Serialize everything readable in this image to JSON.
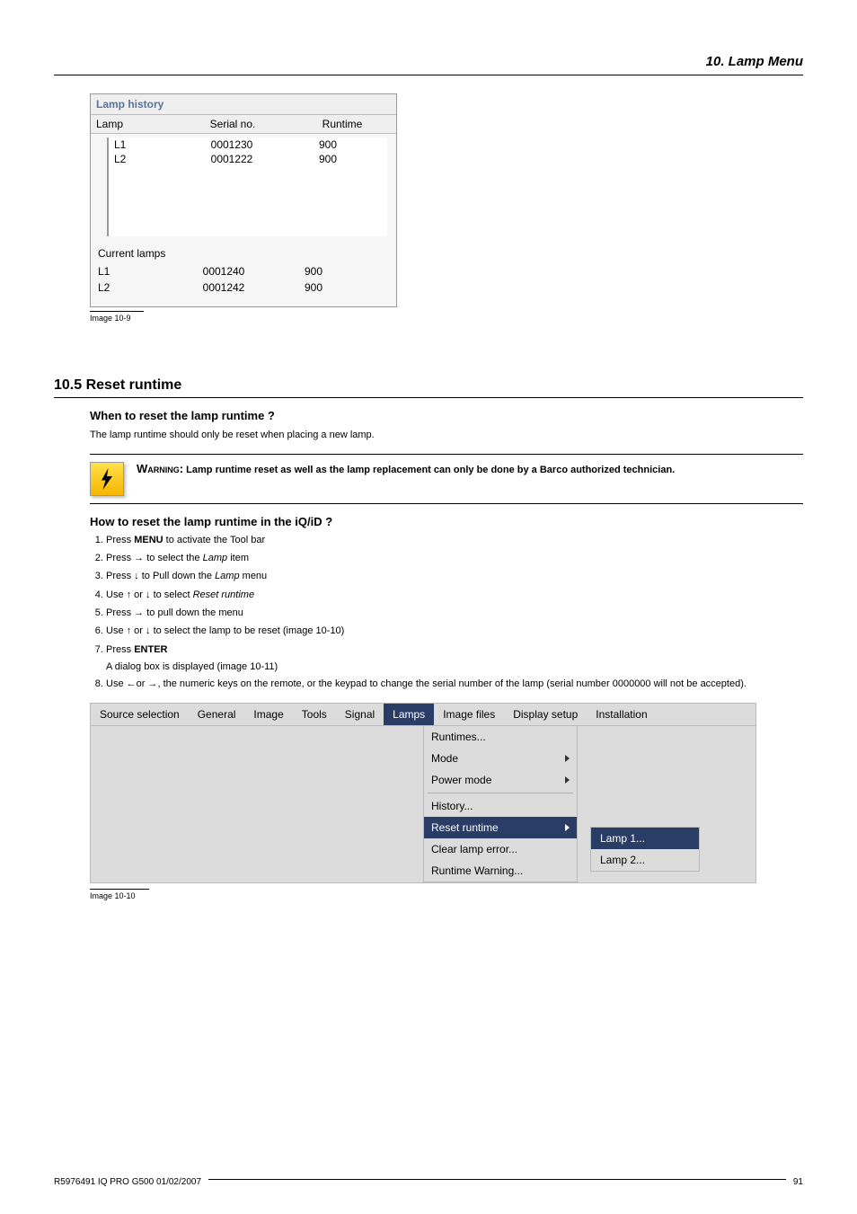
{
  "chapter_header": "10.  Lamp Menu",
  "lamp_history": {
    "title": "Lamp history",
    "columns": [
      "Lamp",
      "Serial no.",
      "Runtime"
    ],
    "rows": [
      {
        "lamp": "L1",
        "serial": "0001230",
        "runtime": "900"
      },
      {
        "lamp": "L2",
        "serial": "0001222",
        "runtime": "900"
      }
    ],
    "current_title": "Current lamps",
    "current_rows": [
      {
        "lamp": "L1",
        "serial": "0001240",
        "runtime": "900"
      },
      {
        "lamp": "L2",
        "serial": "0001242",
        "runtime": "900"
      }
    ]
  },
  "caption_10_9": "Image 10-9",
  "section_10_5_heading": "10.5  Reset runtime",
  "subheading_when": "When to reset the lamp runtime ?",
  "when_paragraph": "The lamp runtime should only be reset when placing a new lamp.",
  "warning_label": "Warning:",
  "warning_text": "Lamp runtime reset as well as the lamp replacement can only be done by a Barco authorized technician.",
  "subheading_how": "How to reset the lamp runtime in the iQ/iD ?",
  "steps": [
    {
      "pre": "Press ",
      "bold": "MENU",
      "post": " to activate the Tool bar"
    },
    {
      "pre": "Press → to select the ",
      "italic": "Lamp",
      "post": " item"
    },
    {
      "pre": "Press ↓ to Pull down the ",
      "italic": "Lamp",
      "post": " menu"
    },
    {
      "pre": "Use ↑ or ↓ to select ",
      "italic": "Reset runtime",
      "post": ""
    },
    {
      "pre": "Press → to pull down the menu",
      "post": ""
    },
    {
      "pre": "Use ↑ or ↓ to select the lamp to be reset (image 10-10)",
      "post": ""
    },
    {
      "pre": "Press ",
      "bold": "ENTER",
      "post": ""
    }
  ],
  "step7_followon": "A dialog box is displayed (image 10-11)",
  "step8": "Use ←or →, the numeric keys on the remote, or the keypad to change the serial number of the lamp (serial number 0000000 will not be accepted).",
  "menubar": [
    "Source selection",
    "General",
    "Image",
    "Tools",
    "Signal",
    "Lamps",
    "Image files",
    "Display setup",
    "Installation"
  ],
  "menubar_active_index": 5,
  "lamps_menu": [
    {
      "label": "Runtimes...",
      "arrow": false,
      "selected": false
    },
    {
      "label": "Mode",
      "arrow": true,
      "selected": false
    },
    {
      "label": "Power mode",
      "arrow": true,
      "selected": false
    },
    {
      "separator": true
    },
    {
      "label": "History...",
      "arrow": false,
      "selected": false
    },
    {
      "label": "Reset runtime",
      "arrow": true,
      "selected": true
    },
    {
      "label": "Clear lamp error...",
      "arrow": false,
      "selected": false
    },
    {
      "label": "Runtime Warning...",
      "arrow": false,
      "selected": false
    }
  ],
  "reset_submenu": [
    {
      "label": "Lamp 1...",
      "selected": true
    },
    {
      "label": "Lamp 2...",
      "selected": false
    }
  ],
  "caption_10_10": "Image 10-10",
  "footer_left": "R5976491  IQ PRO G500  01/02/2007",
  "footer_right": "91"
}
